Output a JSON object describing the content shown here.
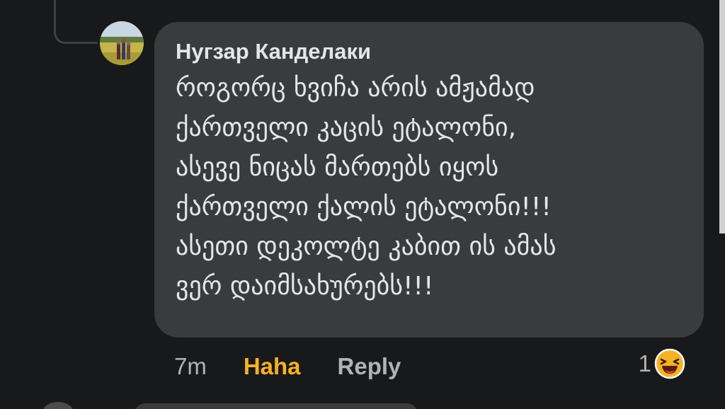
{
  "comment": {
    "author": "Нугзар Канделаки",
    "text_lines": [
      "როგორც ხვიჩა არის ამჟამად",
      "ქართველი კაცის ეტალონი,",
      "ასევე ნიცას მართებს იყოს",
      "ქართველი ქალის ეტალონი!!!",
      "ასეთი დეკოლტე კაბით ის ამას",
      "ვერ დაიმსახურებს!!!"
    ],
    "time": "7m",
    "reaction_label": "Haha",
    "reply_label": "Reply",
    "reaction_count": "1",
    "reaction_icon": "laughing-emoji-icon"
  },
  "colors": {
    "background": "#18191a",
    "bubble": "#3a3b3c",
    "text": "#e4e6eb",
    "secondary": "#b0b3b8",
    "haha_accent": "#f7b125"
  }
}
